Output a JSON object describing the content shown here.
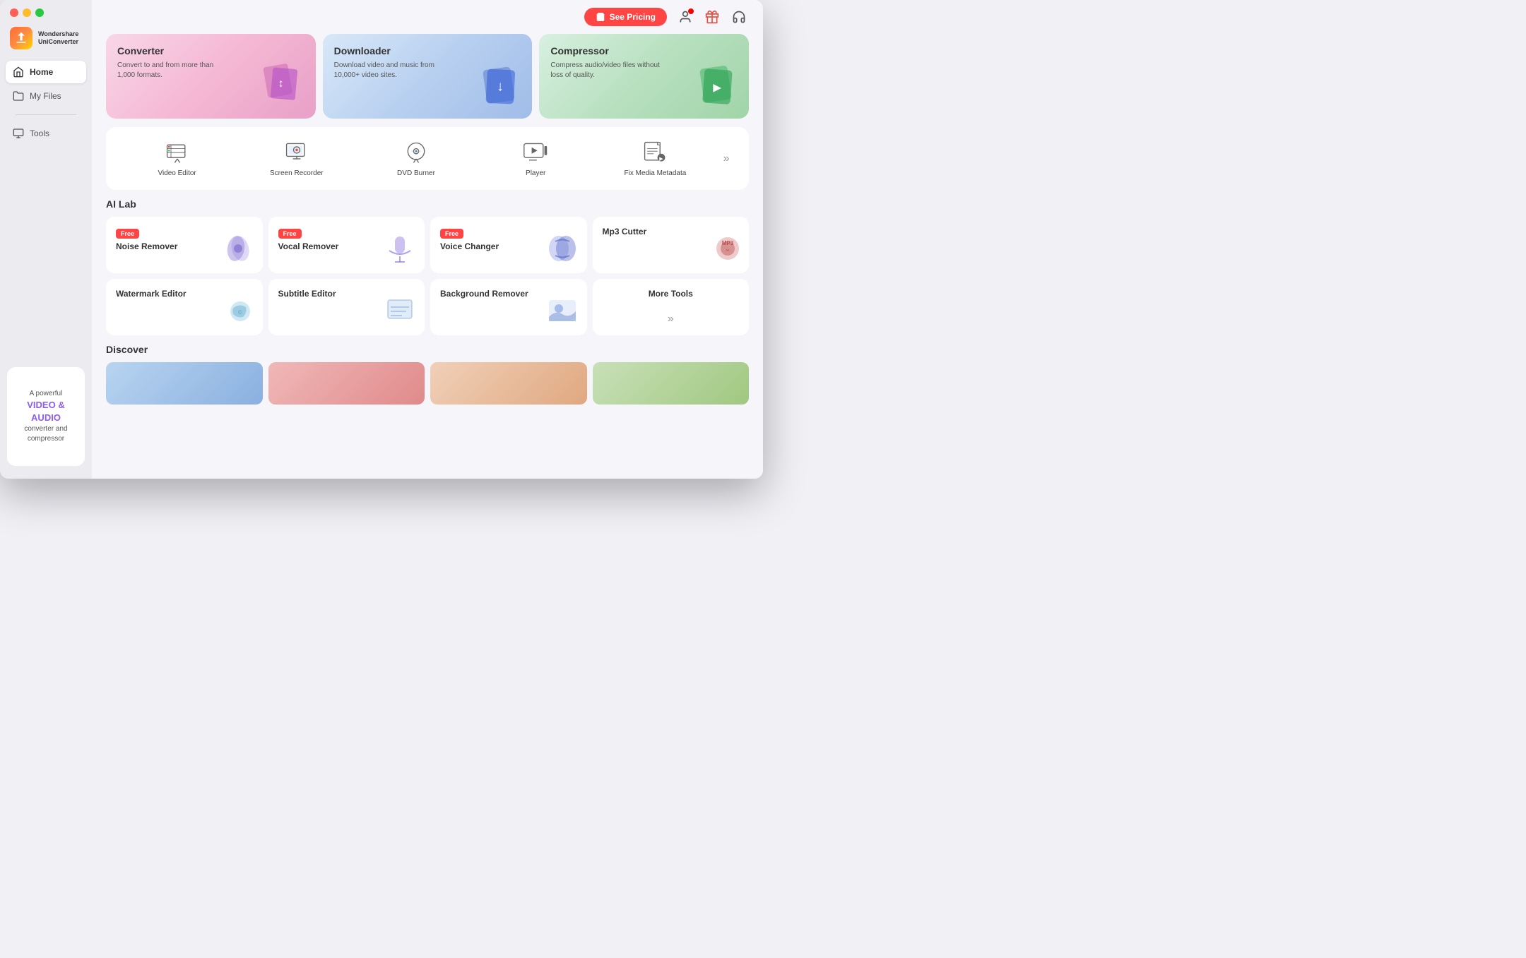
{
  "app": {
    "title": "Wondershare UniConverter",
    "window_controls": [
      "close",
      "minimize",
      "maximize"
    ]
  },
  "header": {
    "see_pricing_label": "See Pricing",
    "cart_icon": "cart-icon",
    "user_icon": "user-icon",
    "gift_icon": "gift-icon",
    "headset_icon": "headset-icon"
  },
  "sidebar": {
    "logo_line1": "Wondershare",
    "logo_line2": "UniConverter",
    "nav_items": [
      {
        "id": "home",
        "label": "Home",
        "active": true
      },
      {
        "id": "my-files",
        "label": "My Files",
        "active": false
      },
      {
        "id": "tools",
        "label": "Tools",
        "active": false
      }
    ],
    "ad": {
      "line1": "A powerful",
      "highlight1": "VIDEO &",
      "highlight2": "AUDIO",
      "line2": "converter and",
      "line3": "compressor"
    }
  },
  "top_cards": [
    {
      "id": "converter",
      "title": "Converter",
      "description": "Convert to and from more than 1,000 formats.",
      "color_class": "converter"
    },
    {
      "id": "downloader",
      "title": "Downloader",
      "description": "Download video and music from 10,000+ video sites.",
      "color_class": "downloader"
    },
    {
      "id": "compressor",
      "title": "Compressor",
      "description": "Compress audio/video files without loss of quality.",
      "color_class": "compressor"
    }
  ],
  "tools": {
    "items": [
      {
        "id": "video-editor",
        "label": "Video Editor"
      },
      {
        "id": "screen-recorder",
        "label": "Screen Recorder"
      },
      {
        "id": "dvd-burner",
        "label": "DVD Burner"
      },
      {
        "id": "player",
        "label": "Player"
      },
      {
        "id": "fix-media-metadata",
        "label": "Fix Media Metadata"
      }
    ],
    "more_arrow": "»"
  },
  "ai_lab": {
    "section_title": "AI Lab",
    "row1": [
      {
        "id": "noise-remover",
        "label": "Noise Remover",
        "free": true
      },
      {
        "id": "vocal-remover",
        "label": "Vocal Remover",
        "free": true
      },
      {
        "id": "voice-changer",
        "label": "Voice Changer",
        "free": true
      },
      {
        "id": "mp3-cutter",
        "label": "Mp3 Cutter",
        "free": false
      }
    ],
    "row2": [
      {
        "id": "watermark-editor",
        "label": "Watermark Editor",
        "free": false
      },
      {
        "id": "subtitle-editor",
        "label": "Subtitle Editor",
        "free": false
      },
      {
        "id": "background-remover",
        "label": "Background Remover",
        "free": false
      },
      {
        "id": "more-tools",
        "label": "More Tools",
        "free": false,
        "is_more": true
      }
    ],
    "free_badge_label": "Free",
    "more_arrow": "»"
  },
  "discover": {
    "section_title": "Discover"
  }
}
